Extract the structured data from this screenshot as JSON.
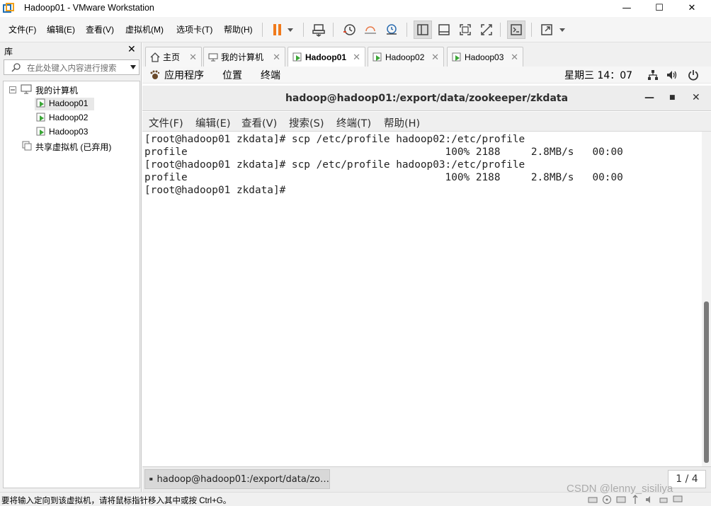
{
  "window": {
    "title": "Hadoop01 - VMware Workstation",
    "controls": [
      "—",
      "☐",
      "✕"
    ]
  },
  "menubar": {
    "items": [
      "文件(F)",
      "编辑(E)",
      "查看(V)",
      "虚拟机(M)",
      "选项卡(T)",
      "帮助(H)"
    ]
  },
  "library": {
    "title": "库",
    "close": "✕",
    "search_placeholder": "在此处键入内容进行搜索",
    "tree": {
      "root": "我的计算机",
      "vms": [
        "Hadoop01",
        "Hadoop02",
        "Hadoop03"
      ],
      "shared": "共享虚拟机 (已弃用)"
    }
  },
  "tabs": [
    {
      "label": "主页",
      "close": "✕"
    },
    {
      "label": "我的计算机",
      "close": "✕"
    },
    {
      "label": "Hadoop01",
      "close": "✕"
    },
    {
      "label": "Hadoop02",
      "close": "✕"
    },
    {
      "label": "Hadoop03",
      "close": "✕"
    }
  ],
  "active_tab": "Hadoop01",
  "guest": {
    "topbar": {
      "menus": [
        "应用程序",
        "位置",
        "终端"
      ],
      "clock": "星期三 14：07"
    },
    "terminal": {
      "title": "hadoop@hadoop01:/export/data/zookeeper/zkdata",
      "controls": [
        "—",
        "■",
        "✕"
      ],
      "menu": [
        "文件(F)",
        "编辑(E)",
        "查看(V)",
        "搜索(S)",
        "终端(T)",
        "帮助(H)"
      ],
      "lines": [
        "[root@hadoop01 zkdata]# scp /etc/profile hadoop02:/etc/profile",
        "profile                                          100% 2188     2.8MB/s   00:00",
        "[root@hadoop01 zkdata]# scp /etc/profile hadoop03:/etc/profile",
        "profile                                          100% 2188     2.8MB/s   00:00",
        "[root@hadoop01 zkdata]# "
      ]
    },
    "taskbar": {
      "item_label": "hadoop@hadoop01:/export/data/zo…",
      "pager": "1 / 4"
    }
  },
  "statusbar": {
    "text": "要将输入定向到该虚拟机，请将鼠标指针移入其中或按 Ctrl+G。"
  },
  "watermark": "CSDN @lenny_sisiliya",
  "colors": {
    "pause_orange": "#f07a1c",
    "vm_green": "#3aa636",
    "icon_blue": "#2b6cb0"
  }
}
